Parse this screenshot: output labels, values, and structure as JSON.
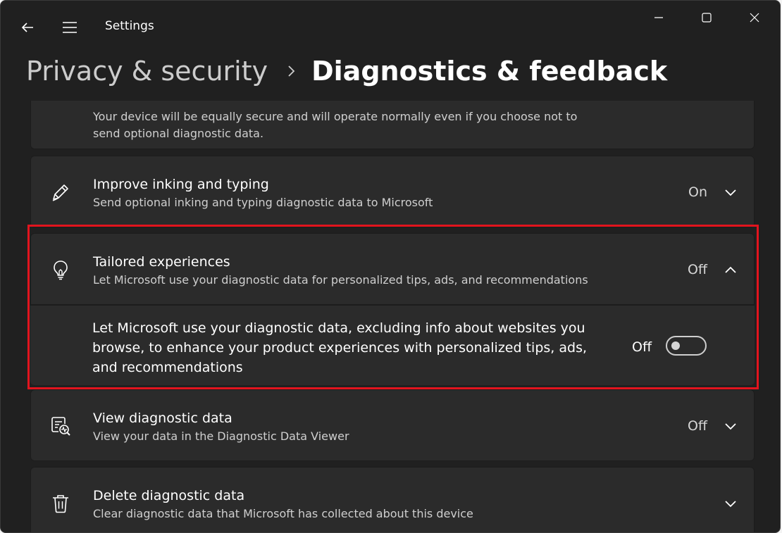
{
  "window": {
    "title": "Settings"
  },
  "breadcrumb": {
    "parent": "Privacy & security",
    "current": "Diagnostics & feedback"
  },
  "cards": {
    "top_partial": {
      "desc_line1": "Your device will be equally secure and will operate normally even if you choose not to",
      "desc_line2": "send optional diagnostic data."
    },
    "inking": {
      "title": "Improve inking and typing",
      "desc": "Send optional inking and typing diagnostic data to Microsoft",
      "status": "On",
      "icon": "pen-icon"
    },
    "tailored": {
      "title": "Tailored experiences",
      "desc": "Let Microsoft use your diagnostic data for personalized tips, ads, and recommendations",
      "status": "Off",
      "icon": "lightbulb-icon",
      "expanded": true,
      "sub_text": "Let Microsoft use your diagnostic data, excluding info about websites you browse, to enhance your product experiences with personalized tips, ads, and recommendations",
      "toggle_label": "Off",
      "toggle_on": false
    },
    "view": {
      "title": "View diagnostic data",
      "desc": "View your data in the Diagnostic Data Viewer",
      "status": "Off",
      "icon": "diagnostic-viewer-icon"
    },
    "delete": {
      "title": "Delete diagnostic data",
      "desc": "Clear diagnostic data that Microsoft has collected about this device",
      "icon": "trash-icon"
    }
  },
  "colors": {
    "highlight": "#e2141e",
    "background": "#202020",
    "card": "#2b2b2b"
  }
}
